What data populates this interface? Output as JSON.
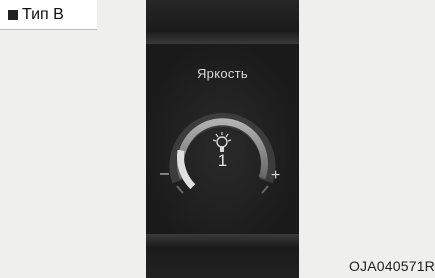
{
  "badge": {
    "square_icon": "black-square-icon",
    "label": "Тип B"
  },
  "display": {
    "title": "Яркость",
    "value": "1",
    "level_fraction": 0.2,
    "minus_label": "–",
    "plus_label": "+",
    "icon": "brightness-adjust-icon"
  },
  "figure": {
    "code": "OJA040571R"
  }
}
